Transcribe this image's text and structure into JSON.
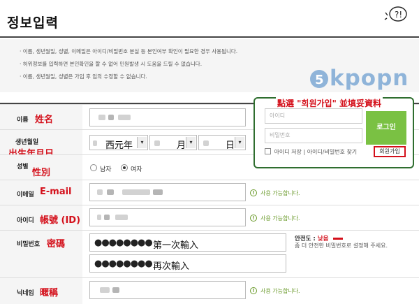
{
  "page": {
    "title": "정보입력"
  },
  "notice": {
    "lines": [
      "· 이름, 생년월일, 성별, 이메일은 아이디/비밀번호 분실 등 본인여부 확인이 필요한 경우 사용됩니다.",
      "· 허위정보를 입력하면 본인확인을 할 수 없어 민원발생 시 도움을 드릴 수 없습니다.",
      "· 이름, 생년월일, 성별은 가입 후 임의 수정할 수 없습니다."
    ]
  },
  "watermark": {
    "text": "kpopn"
  },
  "form": {
    "name": {
      "label": "이름",
      "annotation": "姓名"
    },
    "birth": {
      "label": "생년월일",
      "annotation": "出生年月日",
      "year_suffix": "西元年",
      "month_suffix": "月",
      "day_suffix": "日"
    },
    "gender": {
      "label": "성별",
      "annotation": "性別",
      "options": [
        "남자",
        "여자"
      ],
      "selected": "여자"
    },
    "email": {
      "label": "이메일",
      "annotation": "E-mail",
      "status": "사용 가능합니다."
    },
    "userid": {
      "label": "아이디",
      "annotation": "帳號 (ID)",
      "status": "사용 가능합니다."
    },
    "password": {
      "label": "비밀번호",
      "annotation": "密碼",
      "masked": "●●●●●●●●",
      "first_note": "第一次輸入",
      "confirm_note": "再次輸入",
      "strength_label": "안전도 :",
      "strength_value": "낮음",
      "hint": "좀 더 안전한 비밀번호로 설정해 주세요."
    },
    "nickname": {
      "label": "닉네임",
      "annotation": "暱稱",
      "status": "사용 가능합니다."
    }
  },
  "login_panel": {
    "caption": "點選 \"회원가입\" 並填妥資料",
    "id_placeholder": "아이디",
    "pw_placeholder": "비밀번호",
    "login_button": "로그인",
    "save_id_label": "아이디 저장",
    "find_label": "아이디/비밀번호 찾기",
    "separator": "|",
    "join_button": "회원가입"
  },
  "colors": {
    "accent_red": "#d4101b",
    "login_green": "#7ac143",
    "ok_green": "#6a9a2a"
  }
}
